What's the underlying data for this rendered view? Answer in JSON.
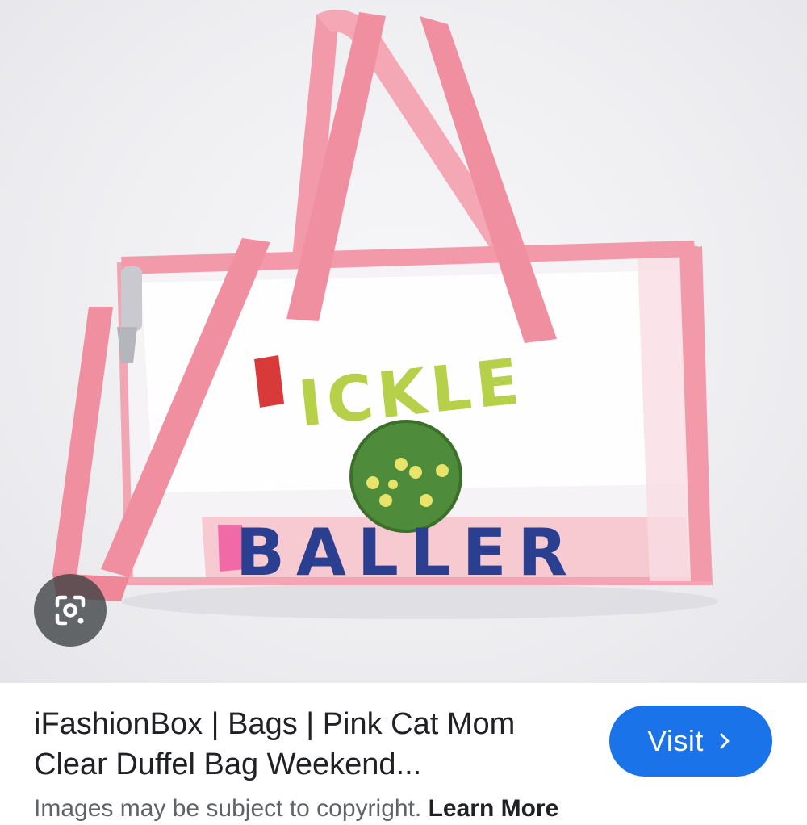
{
  "result": {
    "image_alt": "Clear pink duffel bag with PICKLE BALLER lettering",
    "bag_print": {
      "top_word": "ICKLE",
      "bottom_word": "BALLER"
    },
    "title_line1": "iFashionBox | Bags | Pink Cat Mom",
    "title_line2": "Clear Duffel Bag Weekend...",
    "visit_label": "Visit",
    "copyright_text": "Images may be subject to copyright.",
    "learn_more_label": "Learn More"
  },
  "icons": {
    "lens": "lens-search-icon",
    "visit_arrow": "chevron-right-icon"
  },
  "colors": {
    "visit_button": "#1a73e8",
    "bag_pink": "#f08fa0",
    "title_text": "#202124"
  }
}
